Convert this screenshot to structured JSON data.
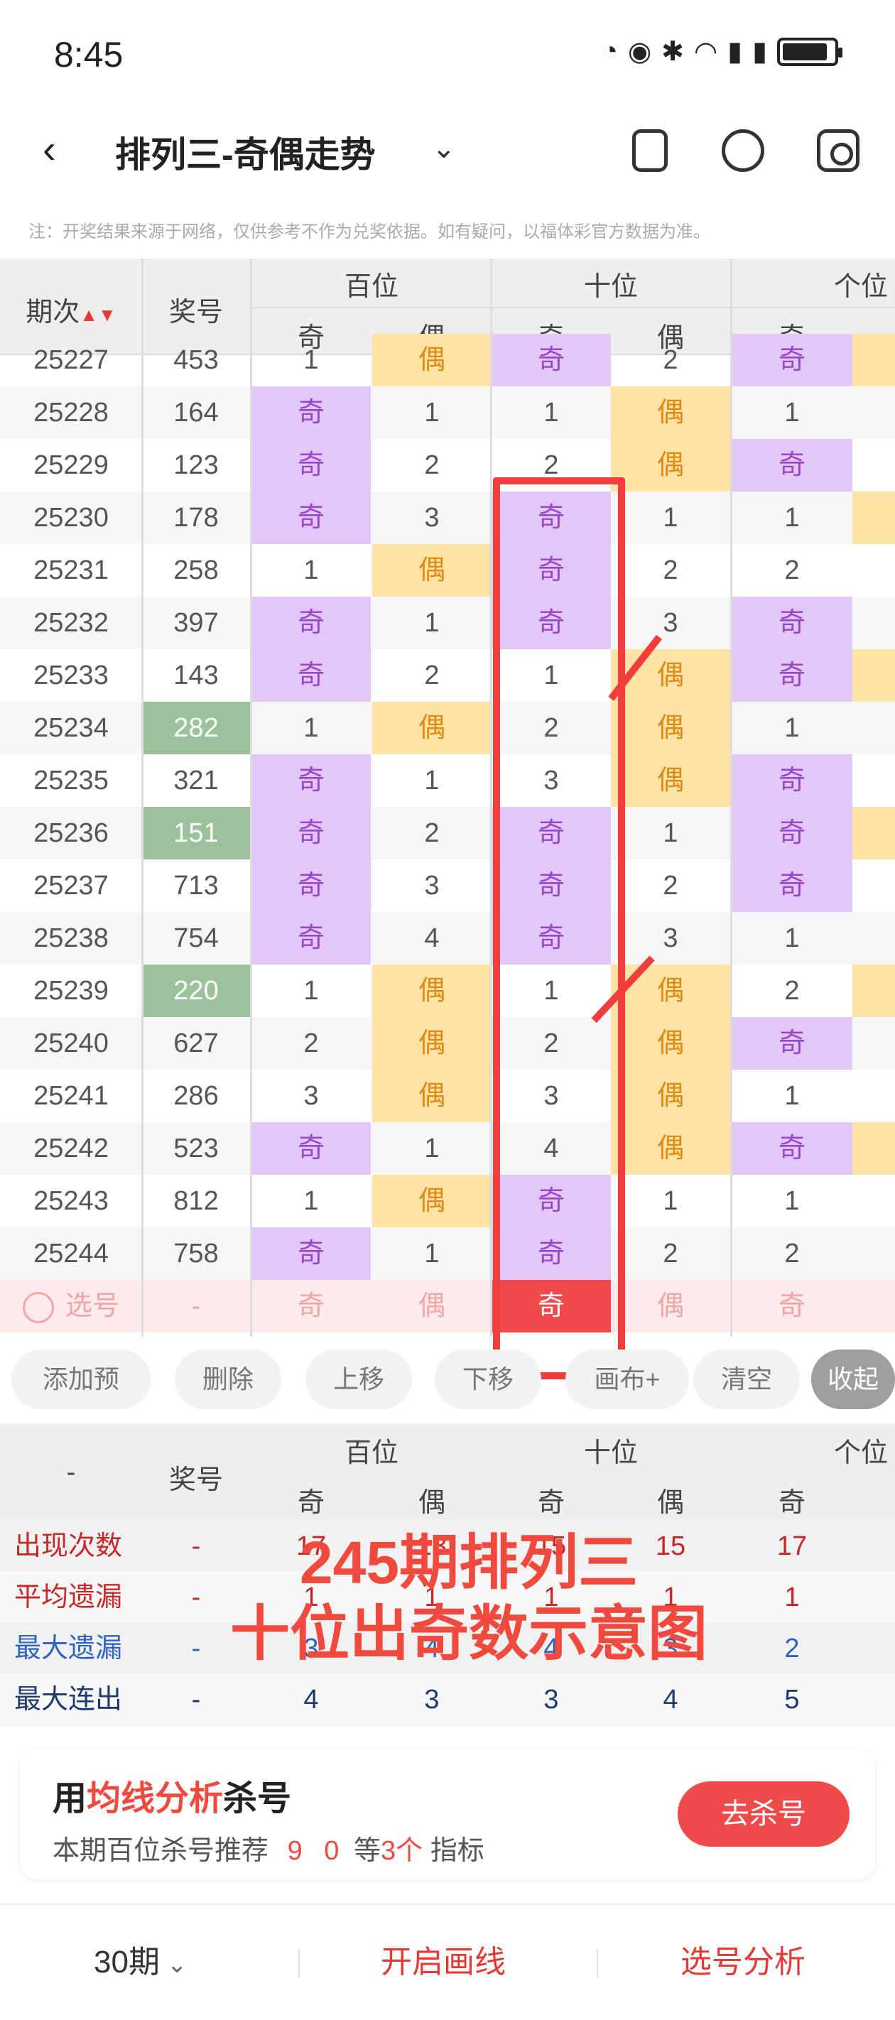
{
  "status_bar": {
    "time": "8:45"
  },
  "header": {
    "title": "排列三-奇偶走势",
    "chevron": "⌄"
  },
  "notice": "注：开奖结果来源于网络，仅供参考不作为兑奖依据。如有疑问，以福体彩官方数据为准。",
  "table_header": {
    "period": "期次",
    "number": "奖号",
    "groups": [
      "百位",
      "十位",
      "个位"
    ],
    "subcols": [
      "奇",
      "偶",
      "奇",
      "偶",
      "奇"
    ]
  },
  "rows": [
    {
      "period": "25227",
      "number": "453",
      "cells": [
        "1",
        "偶",
        "奇",
        "2",
        "奇"
      ],
      "types": [
        "",
        "even",
        "odd",
        "",
        "odd"
      ],
      "hl": false
    },
    {
      "period": "25228",
      "number": "164",
      "cells": [
        "奇",
        "1",
        "1",
        "偶",
        "1"
      ],
      "types": [
        "odd",
        "",
        "",
        "even",
        ""
      ],
      "hl": false
    },
    {
      "period": "25229",
      "number": "123",
      "cells": [
        "奇",
        "2",
        "2",
        "偶",
        "奇"
      ],
      "types": [
        "odd",
        "",
        "",
        "even",
        "odd"
      ],
      "hl": false
    },
    {
      "period": "25230",
      "number": "178",
      "cells": [
        "奇",
        "3",
        "奇",
        "1",
        "1"
      ],
      "types": [
        "odd",
        "",
        "odd",
        "",
        ""
      ],
      "hl": false
    },
    {
      "period": "25231",
      "number": "258",
      "cells": [
        "1",
        "偶",
        "奇",
        "2",
        "2"
      ],
      "types": [
        "",
        "even",
        "odd",
        "",
        ""
      ],
      "hl": false
    },
    {
      "period": "25232",
      "number": "397",
      "cells": [
        "奇",
        "1",
        "奇",
        "3",
        "奇"
      ],
      "types": [
        "odd",
        "",
        "odd",
        "",
        "odd"
      ],
      "hl": false
    },
    {
      "period": "25233",
      "number": "143",
      "cells": [
        "奇",
        "2",
        "1",
        "偶",
        "奇"
      ],
      "types": [
        "odd",
        "",
        "",
        "even",
        "odd"
      ],
      "hl": false
    },
    {
      "period": "25234",
      "number": "282",
      "cells": [
        "1",
        "偶",
        "2",
        "偶",
        "1"
      ],
      "types": [
        "",
        "even",
        "",
        "even",
        ""
      ],
      "hl": true
    },
    {
      "period": "25235",
      "number": "321",
      "cells": [
        "奇",
        "1",
        "3",
        "偶",
        "奇"
      ],
      "types": [
        "odd",
        "",
        "",
        "even",
        "odd"
      ],
      "hl": false
    },
    {
      "period": "25236",
      "number": "151",
      "cells": [
        "奇",
        "2",
        "奇",
        "1",
        "奇"
      ],
      "types": [
        "odd",
        "",
        "odd",
        "",
        "odd"
      ],
      "hl": true
    },
    {
      "period": "25237",
      "number": "713",
      "cells": [
        "奇",
        "3",
        "奇",
        "2",
        "奇"
      ],
      "types": [
        "odd",
        "",
        "odd",
        "",
        "odd"
      ],
      "hl": false
    },
    {
      "period": "25238",
      "number": "754",
      "cells": [
        "奇",
        "4",
        "奇",
        "3",
        "1"
      ],
      "types": [
        "odd",
        "",
        "odd",
        "",
        ""
      ],
      "hl": false
    },
    {
      "period": "25239",
      "number": "220",
      "cells": [
        "1",
        "偶",
        "1",
        "偶",
        "2"
      ],
      "types": [
        "",
        "even",
        "",
        "even",
        ""
      ],
      "hl": true
    },
    {
      "period": "25240",
      "number": "627",
      "cells": [
        "2",
        "偶",
        "2",
        "偶",
        "奇"
      ],
      "types": [
        "",
        "even",
        "",
        "even",
        "odd"
      ],
      "hl": false
    },
    {
      "period": "25241",
      "number": "286",
      "cells": [
        "3",
        "偶",
        "3",
        "偶",
        "1"
      ],
      "types": [
        "",
        "even",
        "",
        "even",
        ""
      ],
      "hl": false
    },
    {
      "period": "25242",
      "number": "523",
      "cells": [
        "奇",
        "1",
        "4",
        "偶",
        "奇"
      ],
      "types": [
        "odd",
        "",
        "",
        "even",
        "odd"
      ],
      "hl": false
    },
    {
      "period": "25243",
      "number": "812",
      "cells": [
        "1",
        "偶",
        "奇",
        "1",
        "1"
      ],
      "types": [
        "",
        "even",
        "odd",
        "",
        ""
      ],
      "hl": false
    },
    {
      "period": "25244",
      "number": "758",
      "cells": [
        "奇",
        "1",
        "奇",
        "2",
        "2"
      ],
      "types": [
        "odd",
        "",
        "odd",
        "",
        ""
      ],
      "hl": false
    }
  ],
  "pick_row": {
    "label": "选号",
    "number": "-",
    "cells": [
      "奇",
      "偶",
      "奇",
      "偶",
      "奇"
    ],
    "active_index": 2
  },
  "actions": [
    "添加预选",
    "删除",
    "上移",
    "下移",
    "画布+",
    "清空",
    "收起"
  ],
  "stats": {
    "header_dash": "-",
    "number": "奖号",
    "rows": [
      {
        "label": "出现次数",
        "number": "-",
        "values": [
          "17",
          "13",
          "15",
          "15",
          "17"
        ],
        "color": "#c62828"
      },
      {
        "label": "平均遗漏",
        "number": "-",
        "values": [
          "1",
          "1",
          "1",
          "1",
          "1"
        ],
        "color": "#c62828"
      },
      {
        "label": "最大遗漏",
        "number": "-",
        "values": [
          "3",
          "4",
          "4",
          "3",
          "2"
        ],
        "color": "#2e63c0"
      },
      {
        "label": "最大连出",
        "number": "-",
        "values": [
          "4",
          "3",
          "3",
          "4",
          "5"
        ],
        "color": "#1f3a6e"
      }
    ]
  },
  "overlay": {
    "line1": "245期排列三",
    "line2": "十位出奇数示意图"
  },
  "card": {
    "title_pre": "用",
    "title_red": "均线分析",
    "title_post": "杀号",
    "sub_pre": "本期百位杀号推荐",
    "sub_nums": "9 0",
    "sub_mid": "等",
    "sub_count": "3个",
    "sub_post": "指标",
    "button": "去杀号"
  },
  "bottom_bar": {
    "period": "30期",
    "draw": "开启画线",
    "analysis": "选号分析"
  },
  "colors": {
    "odd_bg": "#e2c7f9",
    "even_bg": "#fde3a6",
    "accent_red": "#f04a4a",
    "hl_green": "#9cc29b"
  }
}
